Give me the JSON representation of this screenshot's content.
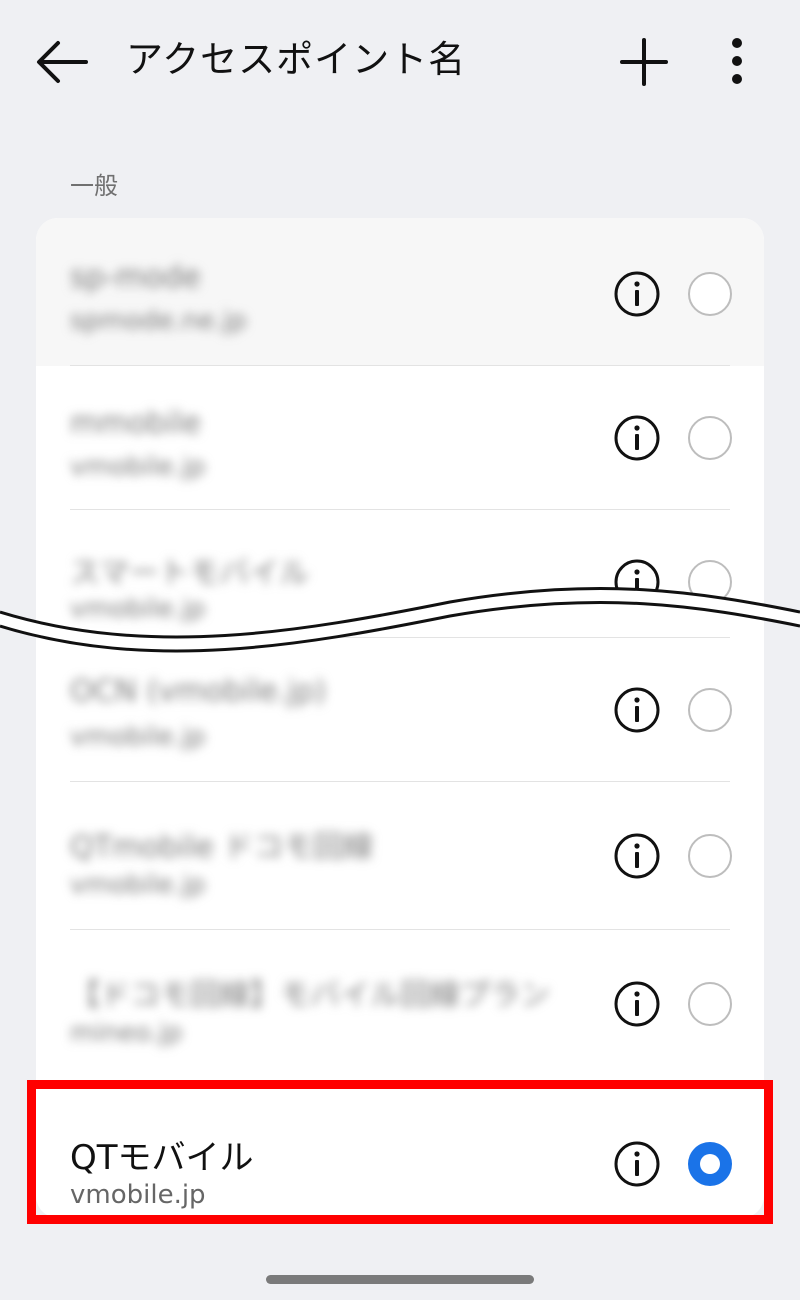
{
  "header": {
    "title": "アクセスポイント名",
    "back_icon": "arrow-back-icon",
    "add_icon": "plus-icon",
    "more_icon": "more-vert-icon"
  },
  "section": {
    "label": "一般"
  },
  "apn_list": [
    {
      "name": "sp-mode",
      "sub": "spmode.ne.jp",
      "selected": false,
      "blurred": true
    },
    {
      "name": "mmobile",
      "sub": "vmobile.jp",
      "selected": false,
      "blurred": true
    },
    {
      "name": "スマートモバイル",
      "sub": "vmobile.jp",
      "selected": false,
      "blurred": true
    },
    {
      "name": "OCN (vmobile.jp)",
      "sub": "vmobile.jp",
      "selected": false,
      "blurred": true
    },
    {
      "name": "QTmobile ドコモ回線",
      "sub": "vmobile.jp",
      "selected": false,
      "blurred": true
    },
    {
      "name": "【ドコモ回線】モバイル回線プラン",
      "sub": "mineo.jp",
      "selected": false,
      "blurred": true
    },
    {
      "name": "QTモバイル",
      "sub": "vmobile.jp",
      "selected": true,
      "blurred": false
    }
  ],
  "colors": {
    "accent": "#1a73e8",
    "highlight": "#ff0000",
    "background": "#eff0f3"
  }
}
